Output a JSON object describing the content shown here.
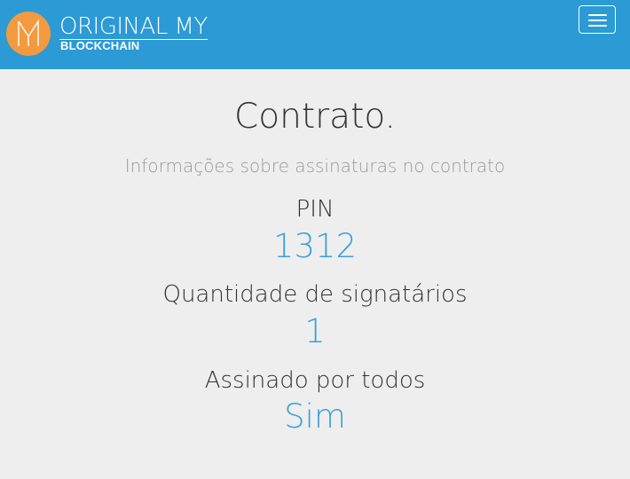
{
  "header": {
    "brand_top": "ORIGINAL MY",
    "brand_bottom": "BLOCKCHAIN",
    "logo_icon": "original-my-logo",
    "menu_icon": "hamburger-menu-icon",
    "background_color": "#2b9ad5",
    "logo_color": "#f39a3f"
  },
  "main": {
    "title": "Contrato.",
    "subtitle": "Informações sobre assinaturas no contrato",
    "fields": [
      {
        "label": "PIN",
        "value": "1312"
      },
      {
        "label": "Quantidade de signatários",
        "value": "1"
      },
      {
        "label": "Assinado por todos",
        "value": "Sim"
      }
    ],
    "value_color": "#3aa0d8"
  }
}
